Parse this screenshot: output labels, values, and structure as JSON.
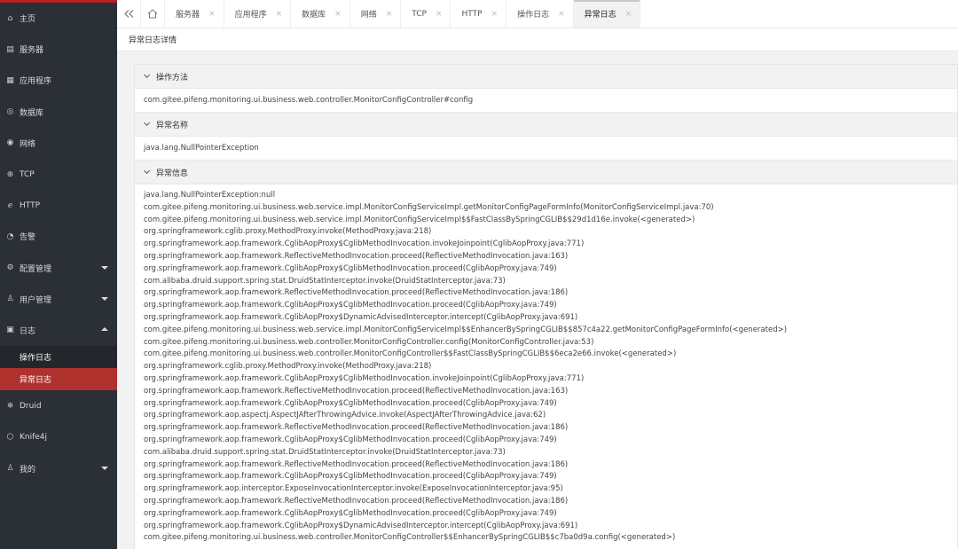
{
  "sidebar": {
    "items": [
      {
        "label": "主页",
        "icon": "home-icon",
        "glyph": "⌂"
      },
      {
        "label": "服务器",
        "icon": "server-icon",
        "glyph": "▤"
      },
      {
        "label": "应用程序",
        "icon": "application-icon",
        "glyph": "▦"
      },
      {
        "label": "数据库",
        "icon": "database-icon",
        "glyph": "◎"
      },
      {
        "label": "网络",
        "icon": "network-icon",
        "glyph": "◉"
      },
      {
        "label": "TCP",
        "icon": "tcp-icon",
        "glyph": "⊕"
      },
      {
        "label": "HTTP",
        "icon": "http-icon",
        "glyph": "ℯ"
      },
      {
        "label": "告警",
        "icon": "alarm-icon",
        "glyph": "◔"
      },
      {
        "label": "配置管理",
        "icon": "config-icon",
        "glyph": "⚙",
        "expandable": true
      },
      {
        "label": "用户管理",
        "icon": "user-manage-icon",
        "glyph": "♙",
        "expandable": true
      },
      {
        "label": "日志",
        "icon": "log-icon",
        "glyph": "▣",
        "expandable": true,
        "expanded": true
      }
    ],
    "log_children": [
      {
        "label": "操作日志",
        "active": false
      },
      {
        "label": "异常日志",
        "active": true
      }
    ],
    "items_after": [
      {
        "label": "Druid",
        "icon": "druid-icon",
        "glyph": "❄"
      },
      {
        "label": "Knife4j",
        "icon": "knife4j-icon",
        "glyph": "⬡"
      },
      {
        "label": "我的",
        "icon": "my-icon",
        "glyph": "♙",
        "expandable": true
      }
    ]
  },
  "tabs": {
    "items": [
      {
        "label": "服务器"
      },
      {
        "label": "应用程序"
      },
      {
        "label": "数据库"
      },
      {
        "label": "网络"
      },
      {
        "label": "TCP"
      },
      {
        "label": "HTTP"
      },
      {
        "label": "操作日志"
      },
      {
        "label": "异常日志",
        "active": true
      }
    ],
    "close_glyph": "×"
  },
  "page": {
    "title": "异常日志详情"
  },
  "sections": {
    "method": {
      "title": "操作方法",
      "value": "com.gitee.pifeng.monitoring.ui.business.web.controller.MonitorConfigController#config"
    },
    "name": {
      "title": "异常名称",
      "value": "java.lang.NullPointerException"
    },
    "info": {
      "title": "异常信息"
    }
  },
  "trace": [
    "java.lang.NullPointerException:null",
    "com.gitee.pifeng.monitoring.ui.business.web.service.impl.MonitorConfigServiceImpl.getMonitorConfigPageFormInfo(MonitorConfigServiceImpl.java:70)",
    "com.gitee.pifeng.monitoring.ui.business.web.service.impl.MonitorConfigServiceImpl$$FastClassBySpringCGLIB$$29d1d16e.invoke(<generated>)",
    "org.springframework.cglib.proxy.MethodProxy.invoke(MethodProxy.java:218)",
    "org.springframework.aop.framework.CglibAopProxy$CglibMethodInvocation.invokeJoinpoint(CglibAopProxy.java:771)",
    "org.springframework.aop.framework.ReflectiveMethodInvocation.proceed(ReflectiveMethodInvocation.java:163)",
    "org.springframework.aop.framework.CglibAopProxy$CglibMethodInvocation.proceed(CglibAopProxy.java:749)",
    "com.alibaba.druid.support.spring.stat.DruidStatInterceptor.invoke(DruidStatInterceptor.java:73)",
    "org.springframework.aop.framework.ReflectiveMethodInvocation.proceed(ReflectiveMethodInvocation.java:186)",
    "org.springframework.aop.framework.CglibAopProxy$CglibMethodInvocation.proceed(CglibAopProxy.java:749)",
    "org.springframework.aop.framework.CglibAopProxy$DynamicAdvisedInterceptor.intercept(CglibAopProxy.java:691)",
    "com.gitee.pifeng.monitoring.ui.business.web.service.impl.MonitorConfigServiceImpl$$EnhancerBySpringCGLIB$$857c4a22.getMonitorConfigPageFormInfo(<generated>)",
    "com.gitee.pifeng.monitoring.ui.business.web.controller.MonitorConfigController.config(MonitorConfigController.java:53)",
    "com.gitee.pifeng.monitoring.ui.business.web.controller.MonitorConfigController$$FastClassBySpringCGLIB$$6eca2e66.invoke(<generated>)",
    "org.springframework.cglib.proxy.MethodProxy.invoke(MethodProxy.java:218)",
    "org.springframework.aop.framework.CglibAopProxy$CglibMethodInvocation.invokeJoinpoint(CglibAopProxy.java:771)",
    "org.springframework.aop.framework.ReflectiveMethodInvocation.proceed(ReflectiveMethodInvocation.java:163)",
    "org.springframework.aop.framework.CglibAopProxy$CglibMethodInvocation.proceed(CglibAopProxy.java:749)",
    "org.springframework.aop.aspectj.AspectJAfterThrowingAdvice.invoke(AspectJAfterThrowingAdvice.java:62)",
    "org.springframework.aop.framework.ReflectiveMethodInvocation.proceed(ReflectiveMethodInvocation.java:186)",
    "org.springframework.aop.framework.CglibAopProxy$CglibMethodInvocation.proceed(CglibAopProxy.java:749)",
    "com.alibaba.druid.support.spring.stat.DruidStatInterceptor.invoke(DruidStatInterceptor.java:73)",
    "org.springframework.aop.framework.ReflectiveMethodInvocation.proceed(ReflectiveMethodInvocation.java:186)",
    "org.springframework.aop.framework.CglibAopProxy$CglibMethodInvocation.proceed(CglibAopProxy.java:749)",
    "org.springframework.aop.interceptor.ExposeInvocationInterceptor.invoke(ExposeInvocationInterceptor.java:95)",
    "org.springframework.aop.framework.ReflectiveMethodInvocation.proceed(ReflectiveMethodInvocation.java:186)",
    "org.springframework.aop.framework.CglibAopProxy$CglibMethodInvocation.proceed(CglibAopProxy.java:749)",
    "org.springframework.aop.framework.CglibAopProxy$DynamicAdvisedInterceptor.intercept(CglibAopProxy.java:691)",
    "com.gitee.pifeng.monitoring.ui.business.web.controller.MonitorConfigController$$EnhancerBySpringCGLIB$$c7ba0d9a.config(<generated>)"
  ],
  "colors": {
    "sidebar_bg": "#2b2f36",
    "accent": "#b0322f"
  }
}
